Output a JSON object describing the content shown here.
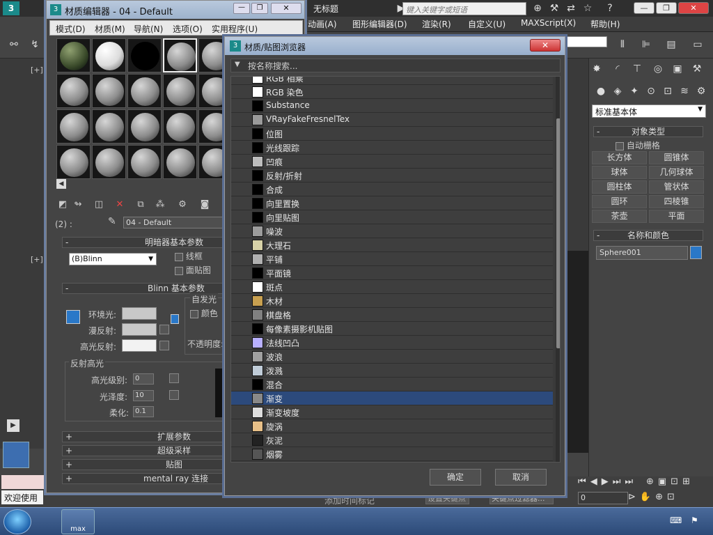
{
  "app": {
    "tab_title": "无标题",
    "search_placeholder": "键入关键字或短语",
    "menu": [
      "动画(A)",
      "图形编辑器(D)",
      "渲染(R)",
      "自定义(U)",
      "MAXScript(X)",
      "帮助(H)"
    ],
    "viewport_labels": [
      "[+]",
      "[+]"
    ]
  },
  "material_editor": {
    "title": "材质编辑器 - 04 - Default",
    "menu": [
      "模式(D)",
      "材质(M)",
      "导航(N)",
      "选项(O)",
      "实用程序(U)"
    ],
    "level_label": "(2) :",
    "material_name": "04 - Default",
    "shader_rollout": "明暗器基本参数",
    "shader_type": "(B)Blinn",
    "wire_label": "线框",
    "facemap_label": "面贴图",
    "blinn_rollout": "Blinn 基本参数",
    "self_illum_label": "自发光",
    "color_label": "颜色",
    "ambient_label": "环境光:",
    "diffuse_label": "漫反射:",
    "specular_label": "高光反射:",
    "opacity_label": "不透明度:",
    "spec_highlights_label": "反射高光",
    "spec_level_label": "高光级别:",
    "spec_level_value": "0",
    "gloss_label": "光泽度:",
    "gloss_value": "10",
    "soften_label": "柔化:",
    "soften_value": "0.1",
    "rollouts": [
      "扩展参数",
      "超级采样",
      "贴图",
      "mental ray 连接"
    ]
  },
  "browser": {
    "title": "材质/贴图浏览器",
    "search_placeholder": "按名称搜索...",
    "items": [
      {
        "label": "RGB 相乘",
        "icon": "#ffffff"
      },
      {
        "label": "RGB 染色",
        "icon": "#ffffff"
      },
      {
        "label": "Substance",
        "icon": "#000000"
      },
      {
        "label": "VRayFakeFresnelTex",
        "icon": "#9a9a9a"
      },
      {
        "label": "位图",
        "icon": "#000000"
      },
      {
        "label": "光线跟踪",
        "icon": "#000000"
      },
      {
        "label": "凹痕",
        "icon": "#bdbdbd"
      },
      {
        "label": "反射/折射",
        "icon": "#000000"
      },
      {
        "label": "合成",
        "icon": "#000000"
      },
      {
        "label": "向里置换",
        "icon": "#000000"
      },
      {
        "label": "向里贴图",
        "icon": "#000000"
      },
      {
        "label": "噪波",
        "icon": "#9c9c9c"
      },
      {
        "label": "大理石",
        "icon": "#d8d2a8"
      },
      {
        "label": "平铺",
        "icon": "#b0b0b0"
      },
      {
        "label": "平面镜",
        "icon": "#000000"
      },
      {
        "label": "斑点",
        "icon": "#ffffff"
      },
      {
        "label": "木材",
        "icon": "#c8a050"
      },
      {
        "label": "棋盘格",
        "icon": "#808080"
      },
      {
        "label": "每像素摄影机贴图",
        "icon": "#000000"
      },
      {
        "label": "法线凹凸",
        "icon": "#b8b0ff"
      },
      {
        "label": "波浪",
        "icon": "#a0a0a0"
      },
      {
        "label": "泼溅",
        "icon": "#c0ccd8"
      },
      {
        "label": "混合",
        "icon": "#000000"
      },
      {
        "label": "渐变",
        "icon": "#888888"
      },
      {
        "label": "渐变坡度",
        "icon": "#dddddd"
      },
      {
        "label": "旋涡",
        "icon": "#e8c088"
      },
      {
        "label": "灰泥",
        "icon": "#222222"
      },
      {
        "label": "烟雾",
        "icon": "#555555"
      }
    ],
    "selected_item": "渐变",
    "ok_label": "确定",
    "cancel_label": "取消"
  },
  "command_panel": {
    "primitive_type": "标准基本体",
    "object_type_rollout": "对象类型",
    "autogrid_label": "自动栅格",
    "objects": [
      "长方体",
      "圆锥体",
      "球体",
      "几何球体",
      "圆柱体",
      "管状体",
      "圆环",
      "四棱锥",
      "茶壶",
      "平面"
    ],
    "name_color_rollout": "名称和颜色",
    "object_name": "Sphere001",
    "object_color": "#2a78c8"
  },
  "status": {
    "welcome": "欢迎使用",
    "add_time_tag": "添加时间标记",
    "set_key": "设置关键点",
    "key_filters": "关键点过滤器...",
    "frame": "0"
  },
  "taskbar": {
    "max_label": "max"
  }
}
